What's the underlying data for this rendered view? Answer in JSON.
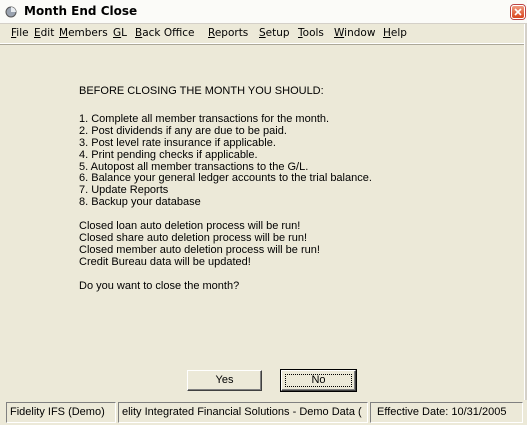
{
  "window": {
    "title": "Month End Close"
  },
  "menu": [
    "File",
    "Edit",
    "Members",
    "GL",
    "Back Office",
    "Reports",
    "Setup",
    "Tools",
    "Window",
    "Help"
  ],
  "message": {
    "heading": "BEFORE CLOSING THE MONTH YOU SHOULD:",
    "steps": [
      "1. Complete all member transactions for the month.",
      "2. Post dividends if any are due to be paid.",
      "3. Post level rate insurance if applicable.",
      "4. Print pending checks if applicable.",
      "5. Autopost all member transactions to the G/L.",
      "6. Balance your general ledger accounts to the trial balance.",
      "7. Update Reports",
      "8. Backup your database"
    ],
    "notices": [
      "Closed loan auto deletion process will be run!",
      "Closed share auto deletion process will be run!",
      "Closed member auto deletion process will be run!",
      "Credit Bureau data will be updated!"
    ],
    "question": "Do you want to close the month?"
  },
  "buttons": {
    "yes": "Yes",
    "no": "No"
  },
  "status": {
    "company": "Fidelity IFS (Demo)",
    "database": "elity Integrated Financial Solutions - Demo Data (",
    "effective_date": "Effective Date: 10/31/2005"
  }
}
